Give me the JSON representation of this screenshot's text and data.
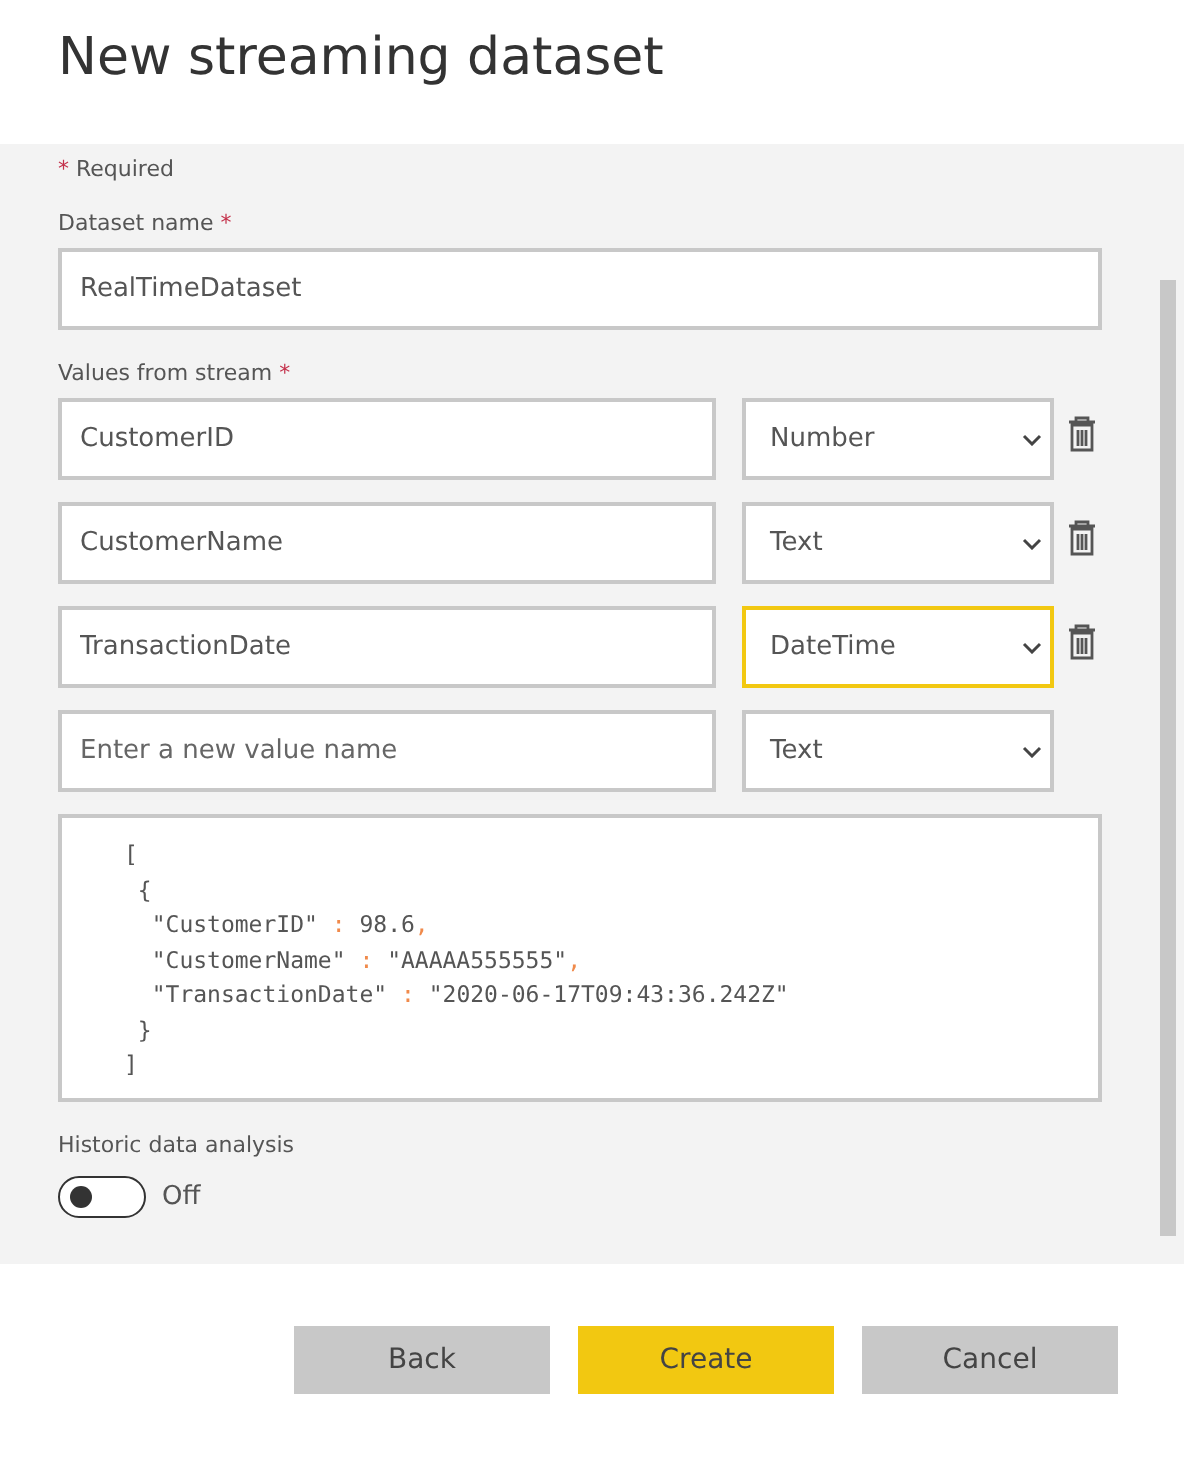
{
  "title": "New streaming dataset",
  "required_note": {
    "mark": "*",
    "text": "Required"
  },
  "dataset_name": {
    "label": "Dataset name",
    "mark": "*",
    "value": "RealTimeDataset"
  },
  "values_label": {
    "label": "Values from stream",
    "mark": "*"
  },
  "values": [
    {
      "name": "CustomerID",
      "type": "Number",
      "focused": false,
      "deletable": true
    },
    {
      "name": "CustomerName",
      "type": "Text",
      "focused": false,
      "deletable": true
    },
    {
      "name": "TransactionDate",
      "type": "DateTime",
      "focused": true,
      "deletable": true
    },
    {
      "placeholder": "Enter a new value name",
      "type": "Text",
      "focused": false,
      "deletable": false
    }
  ],
  "sample": [
    [
      {
        "kind": "plain",
        "text": "["
      }
    ],
    [
      {
        "kind": "plain",
        "text": " {"
      }
    ],
    [
      {
        "kind": "plain",
        "text": "  \"CustomerID\" "
      },
      {
        "kind": "punct",
        "text": ":"
      },
      {
        "kind": "plain",
        "text": " 98.6"
      },
      {
        "kind": "punct",
        "text": ","
      }
    ],
    [
      {
        "kind": "plain",
        "text": "  \"CustomerName\" "
      },
      {
        "kind": "punct",
        "text": ":"
      },
      {
        "kind": "plain",
        "text": " \"AAAAA555555\""
      },
      {
        "kind": "punct",
        "text": ","
      }
    ],
    [
      {
        "kind": "plain",
        "text": "  \"TransactionDate\" "
      },
      {
        "kind": "punct",
        "text": ":"
      },
      {
        "kind": "plain",
        "text": " \"2020-06-17T09:43:36.242Z\""
      }
    ],
    [
      {
        "kind": "plain",
        "text": " }"
      }
    ],
    [
      {
        "kind": "plain",
        "text": "]"
      }
    ]
  ],
  "historic": {
    "label": "Historic data analysis",
    "on": false,
    "state_text": "Off"
  },
  "buttons": [
    {
      "label": "Back",
      "kind": "secondary"
    },
    {
      "label": "Create",
      "kind": "primary"
    },
    {
      "label": "Cancel",
      "kind": "secondary"
    }
  ]
}
